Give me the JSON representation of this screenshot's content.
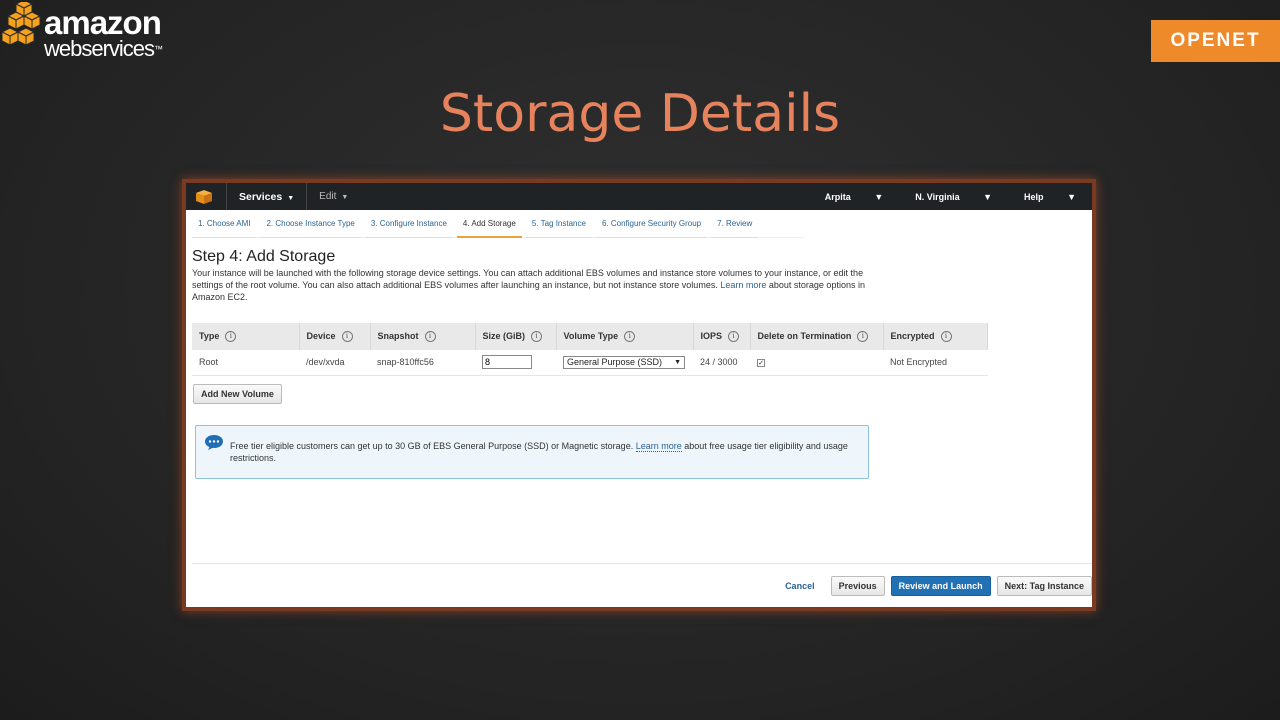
{
  "slide": {
    "logo_line1": "amazon",
    "logo_line2": "webservices",
    "logo_tm": "™",
    "brand": "OPENET",
    "title": "Storage Details",
    "accent_color": "#e7835c",
    "brand_color": "#ef8a2a"
  },
  "console": {
    "topnav": {
      "services": "Services",
      "edit": "Edit",
      "user": "Arpita",
      "region": "N. Virginia",
      "help": "Help"
    },
    "steps": [
      {
        "label": "1. Choose AMI"
      },
      {
        "label": "2. Choose Instance Type"
      },
      {
        "label": "3. Configure Instance"
      },
      {
        "label": "4. Add Storage",
        "active": true
      },
      {
        "label": "5. Tag Instance"
      },
      {
        "label": "6. Configure Security Group"
      },
      {
        "label": "7. Review"
      }
    ],
    "heading": "Step 4: Add Storage",
    "description": {
      "text": "Your instance will be launched with the following storage device settings. You can attach additional EBS volumes and instance store volumes to your instance, or edit the settings of the root volume. You can also attach additional EBS volumes after launching an instance, but not instance store volumes.",
      "link": "Learn more",
      "tail": "about storage options in Amazon EC2."
    },
    "table": {
      "columns": [
        "Type",
        "Device",
        "Snapshot",
        "Size (GiB)",
        "Volume Type",
        "IOPS",
        "Delete on Termination",
        "Encrypted"
      ],
      "row": {
        "type": "Root",
        "device": "/dev/xvda",
        "snapshot": "snap-810ffc56",
        "size": "8",
        "volume_type": "General Purpose (SSD)",
        "iops": "24 / 3000",
        "delete_on_termination": true,
        "encrypted": "Not Encrypted"
      }
    },
    "add_volume_label": "Add New Volume",
    "notice": {
      "text": "Free tier eligible customers can get up to 30 GB of EBS General Purpose (SSD) or Magnetic storage.",
      "link": "Learn more",
      "tail": "about free usage tier eligibility and usage restrictions."
    },
    "footer": {
      "cancel": "Cancel",
      "previous": "Previous",
      "review": "Review and Launch",
      "next": "Next: Tag Instance"
    }
  }
}
